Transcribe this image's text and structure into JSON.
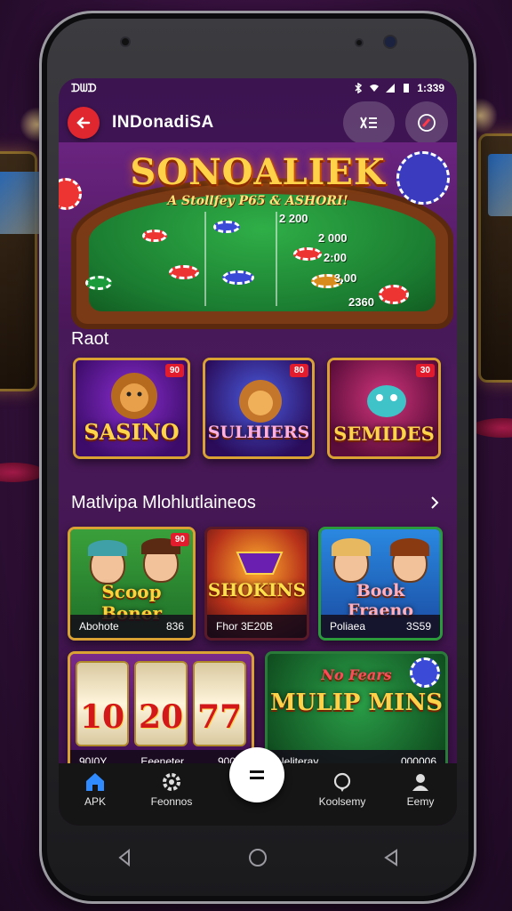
{
  "status_bar": {
    "left": "ᗪᗯᗪ",
    "time": "1:339"
  },
  "header": {
    "title": "INDonadiSA"
  },
  "banner": {
    "title": "SONOALIEK",
    "subtitle": "A Stollfey P65 & ASHORI!",
    "odds": [
      "2 200",
      "2 000",
      "2:00",
      "3.00",
      "2360"
    ]
  },
  "section_recent": {
    "title": "Raot"
  },
  "recent_cards": [
    {
      "name": "SASINO",
      "badge": "90"
    },
    {
      "name": "SULHIERS",
      "badge": "80"
    },
    {
      "name": "SEMIDES",
      "badge": "30"
    }
  ],
  "section_multi": {
    "title": "Matlvipa Mlohlutlaineos"
  },
  "multi_cards": [
    {
      "name": "Scoop Boner",
      "badge": "90",
      "caption_left": "Abohote",
      "caption_right": "836"
    },
    {
      "name": "SHOKINS",
      "caption_left": "Fhor 3E20B",
      "caption_right": ""
    },
    {
      "name": "Book Fraeno",
      "caption_left": "Poliaea",
      "caption_right": "3S59"
    },
    {
      "name": "",
      "reels": [
        "10",
        "20",
        "77"
      ],
      "caption_left": "90I0Y",
      "caption_mid": "Eeeneter",
      "caption_right": "900E"
    },
    {
      "name": "MULIP MINS",
      "subtitle": "No Fears",
      "caption_left": "Neliteray",
      "caption_right": "000006"
    }
  ],
  "bottom_nav": {
    "items": [
      {
        "label": "APK",
        "icon": "home-icon"
      },
      {
        "label": "Feonnos",
        "icon": "gear-icon"
      },
      {
        "label": "Koolsemy",
        "icon": "chat-icon"
      },
      {
        "label": "Eemy",
        "icon": "user-icon"
      }
    ],
    "fab_icon": "equals-icon"
  },
  "colors": {
    "accent": "#e0262f",
    "gold": "#ffd24a",
    "felt": "#1b7d31",
    "nav_active": "#2f8bff"
  }
}
